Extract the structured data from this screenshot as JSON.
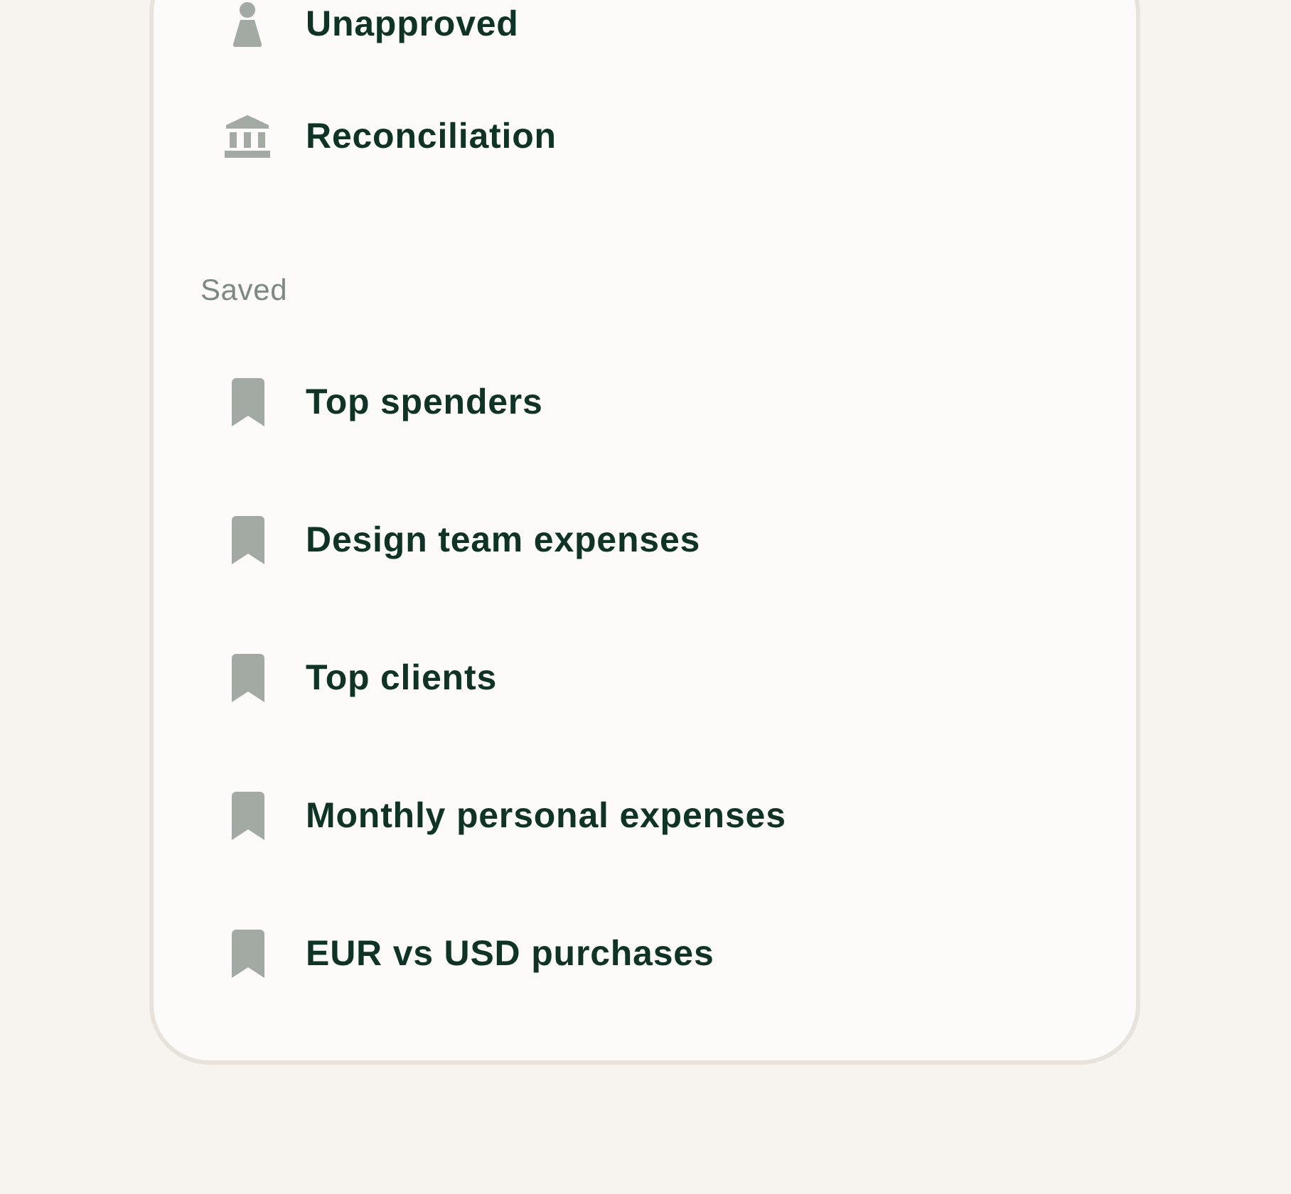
{
  "menu": {
    "sections": [
      {
        "items": [
          {
            "label": "Unapproved",
            "kind": "approval"
          },
          {
            "label": "Reconciliation",
            "kind": "banking"
          }
        ]
      },
      {
        "heading": "Saved",
        "items": [
          {
            "label": "Top spenders",
            "kind": "saved"
          },
          {
            "label": "Design team expenses",
            "kind": "saved"
          },
          {
            "label": "Top clients",
            "kind": "saved"
          },
          {
            "label": "Monthly personal expenses",
            "kind": "saved"
          },
          {
            "label": "EUR vs USD purchases",
            "kind": "saved"
          }
        ]
      }
    ]
  }
}
